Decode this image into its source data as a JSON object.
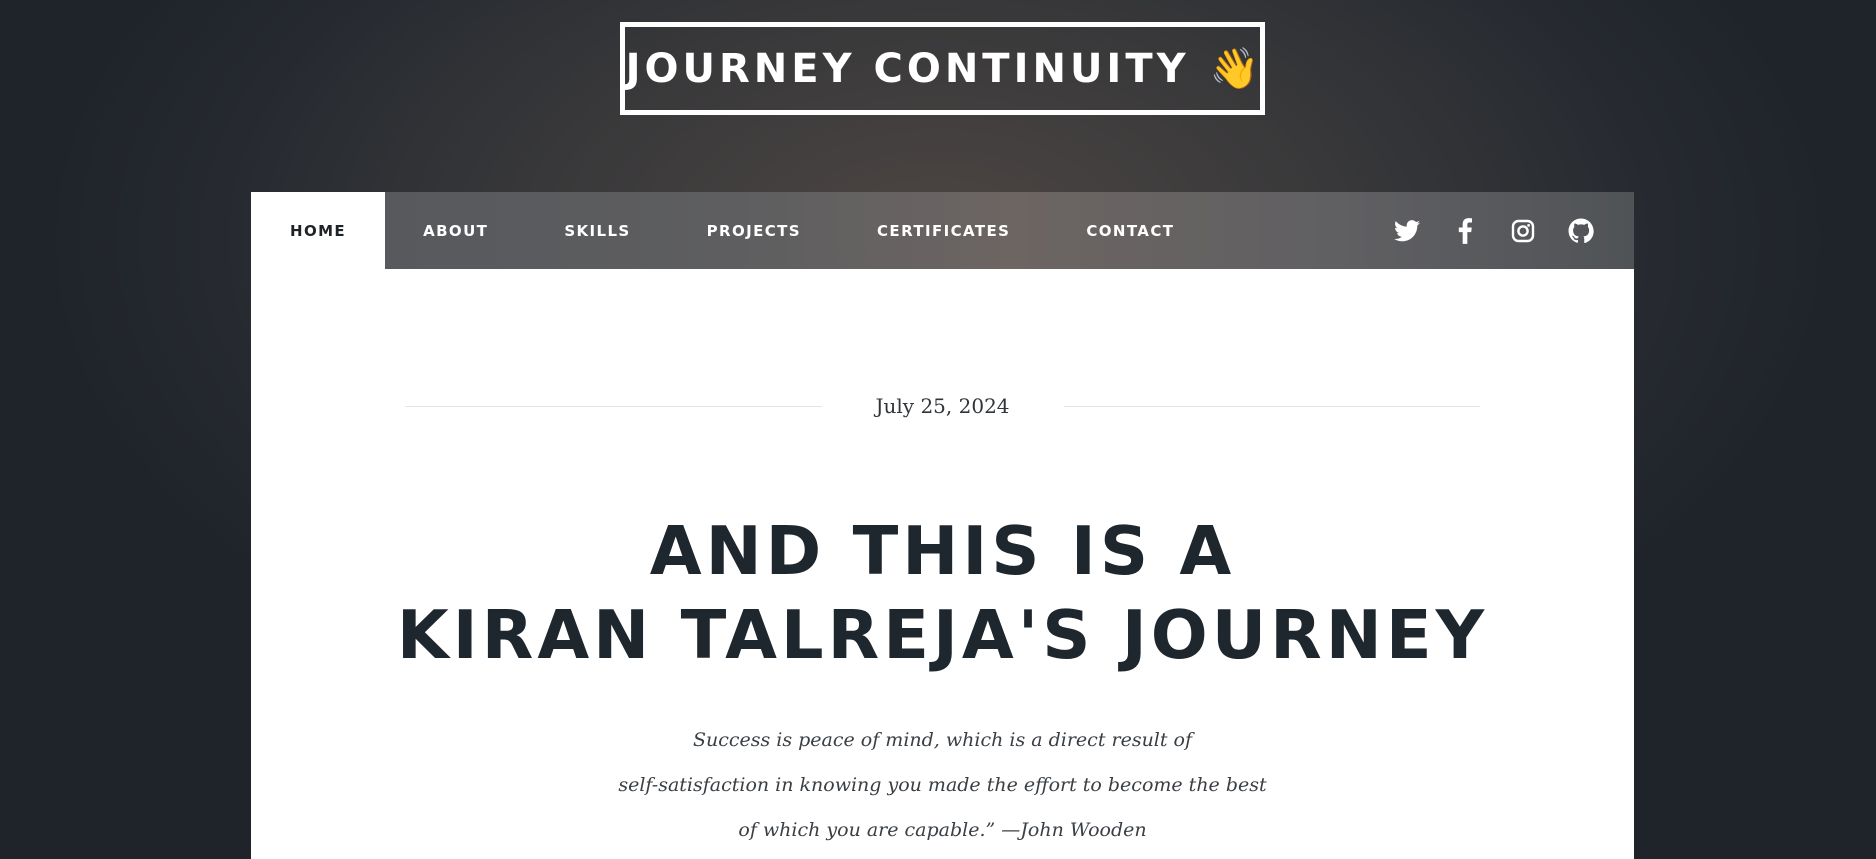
{
  "header": {
    "site_title": "JOURNEY CONTINUITY",
    "wave_emoji": "👋"
  },
  "nav": {
    "items": [
      {
        "label": "HOME",
        "active": true
      },
      {
        "label": "ABOUT",
        "active": false
      },
      {
        "label": "SKILLS",
        "active": false
      },
      {
        "label": "PROJECTS",
        "active": false
      },
      {
        "label": "CERTIFICATES",
        "active": false
      },
      {
        "label": "CONTACT",
        "active": false
      }
    ],
    "social_icons": [
      "twitter-icon",
      "facebook-icon",
      "instagram-icon",
      "github-icon"
    ]
  },
  "post": {
    "date": "July 25, 2024",
    "title_line1": "AND THIS IS A",
    "title_line2": "KIRAN TALREJA'S JOURNEY",
    "quote_line1": "Success is peace of mind, which is a direct result of",
    "quote_line2": "self-satisfaction in knowing you made the effort to become the best",
    "quote_line3": "of which you are capable.” —John Wooden"
  },
  "colors": {
    "nav_text": "#ffffff",
    "active_tab_bg": "#ffffff",
    "heading": "#1e262e",
    "divider": "#e3e5e7"
  }
}
